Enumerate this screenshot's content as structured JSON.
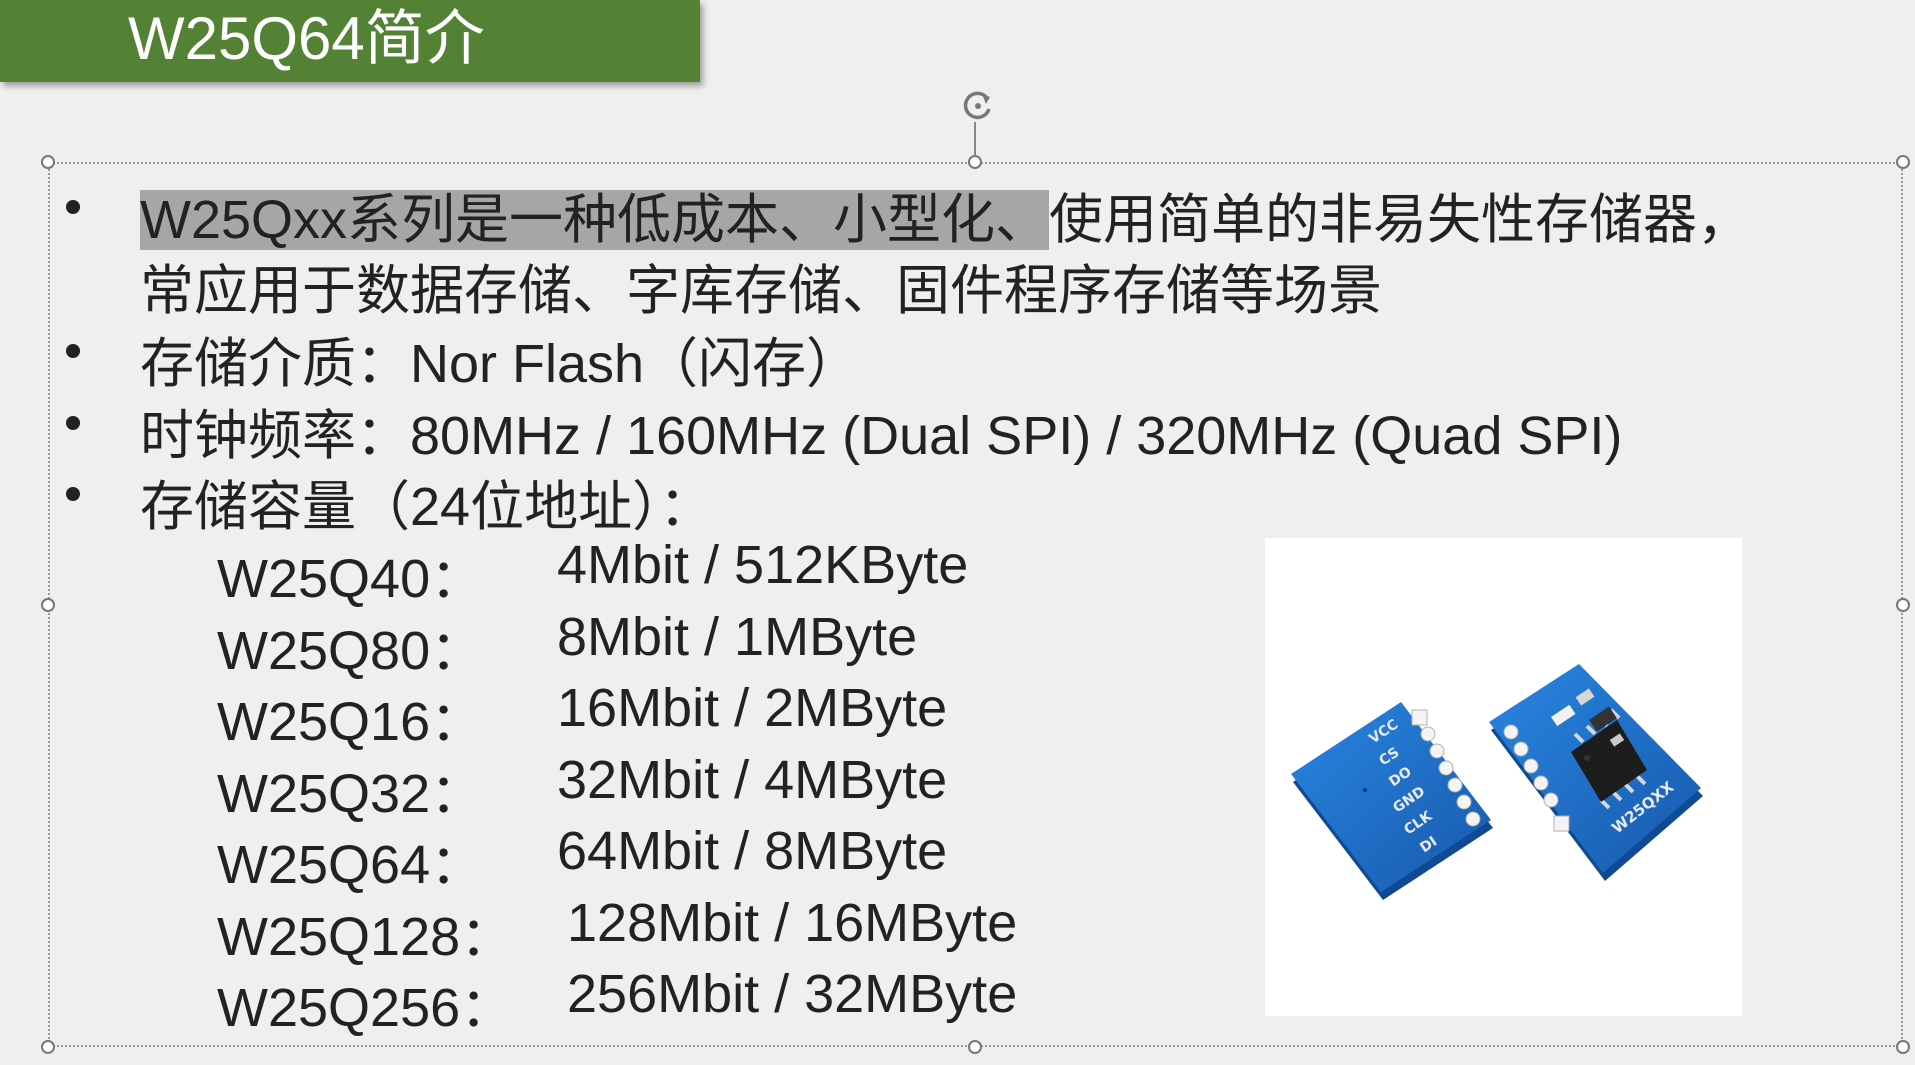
{
  "slide": {
    "title": "W25Q64简介",
    "bullets": [
      {
        "highlighted": "W25Qxx系列是一种低成本、小型化、",
        "rest": "使用简单的非易失性存储器，",
        "line2": "常应用于数据存储、字库存储、固件程序存储等场景"
      },
      {
        "text": "存储介质：Nor Flash（闪存）"
      },
      {
        "text": "时钟频率：80MHz / 160MHz (Dual SPI) / 320MHz (Quad SPI)"
      },
      {
        "text": "存储容量（24位地址）："
      }
    ],
    "capacity_table": [
      {
        "model": "W25Q40：",
        "size": "4Mbit / 512KByte"
      },
      {
        "model": "W25Q80：",
        "size": "8Mbit / 1MByte"
      },
      {
        "model": "W25Q16：",
        "size": "16Mbit / 2MByte"
      },
      {
        "model": "W25Q32：",
        "size": "32Mbit / 4MByte"
      },
      {
        "model": "W25Q64：",
        "size": "64Mbit / 8MByte"
      },
      {
        "model": "W25Q128：",
        "size": "128Mbit / 16MByte"
      },
      {
        "model": "W25Q256：",
        "size": "256Mbit / 32MByte"
      }
    ],
    "module_photo": {
      "pins": [
        "VCC",
        "CS",
        "DO",
        "GND",
        "CLK",
        "DI"
      ],
      "chip_label": "W25QXX",
      "pcb_color": "#1e6fc4"
    }
  }
}
